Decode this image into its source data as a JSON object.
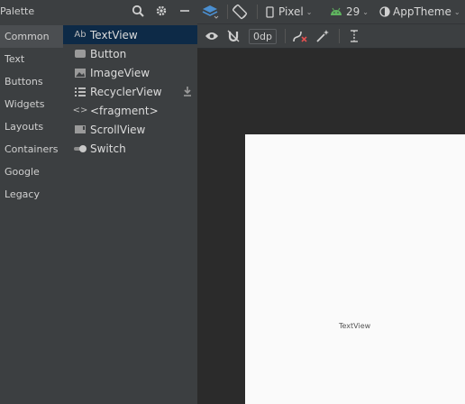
{
  "palette": {
    "title": "Palette",
    "header_icons": [
      "search-icon",
      "gear-icon",
      "minimize-icon"
    ],
    "categories": [
      {
        "label": "Common",
        "selected": true
      },
      {
        "label": "Text"
      },
      {
        "label": "Buttons"
      },
      {
        "label": "Widgets"
      },
      {
        "label": "Layouts"
      },
      {
        "label": "Containers"
      },
      {
        "label": "Google"
      },
      {
        "label": "Legacy"
      }
    ],
    "components": [
      {
        "label": "TextView",
        "icon_text": "Ab",
        "selected": true
      },
      {
        "label": "Button"
      },
      {
        "label": "ImageView"
      },
      {
        "label": "RecyclerView"
      },
      {
        "label": "<fragment>",
        "icon_text": "<>"
      },
      {
        "label": "ScrollView"
      },
      {
        "label": "Switch"
      }
    ]
  },
  "toolbar": {
    "device": "Pixel",
    "api_level": "29",
    "theme": "AppTheme",
    "margin_value": "0dp"
  },
  "canvas": {
    "preview_text": "TextView"
  },
  "colors": {
    "panel_bg": "#3c3f41",
    "selected_component": "#0d2a47",
    "android_green": "#5fb35f",
    "accent_blue": "#4a8fd1"
  }
}
